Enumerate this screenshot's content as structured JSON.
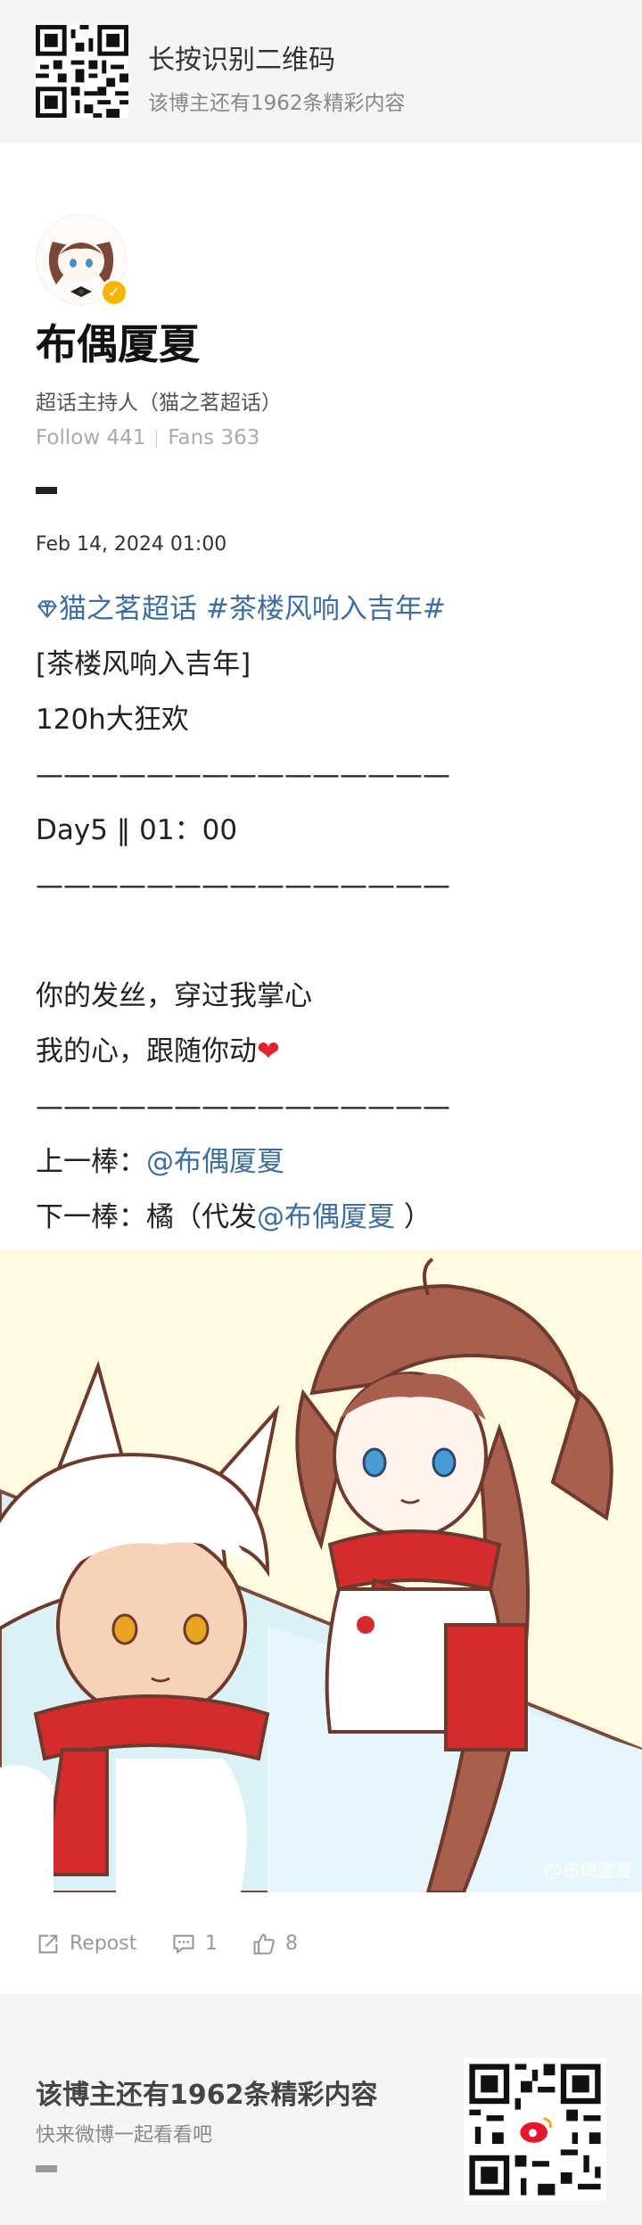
{
  "banner": {
    "title": "长按识别二维码",
    "subtitle": "该博主还有1962条精彩内容"
  },
  "profile": {
    "name": "布偶厦夏",
    "role": "超话主持人（猫之茗超话）",
    "follow_label": "Follow 441",
    "fans_label": "Fans 363",
    "badge_icon": "verified-badge-icon"
  },
  "post": {
    "date": "Feb 14, 2024 01:00",
    "topic_super": "猫之茗超话",
    "topic_tag": "#茶楼风响入吉年#",
    "lines": {
      "l1": "[茶楼风响入吉年]",
      "l2": "120h大狂欢",
      "l3": "———————————————",
      "l4": "Day5 ‖ 01：00",
      "l5": "———————————————",
      "l6": "",
      "l7": "你的发丝，穿过我掌心",
      "l8a": "我的心，跟随你动",
      "l8b": "❤",
      "l9": "———————————————",
      "l10a": "上一棒：",
      "l10b": "@布偶厦夏",
      "l11a": "下一棒：橘（代发",
      "l11b": "@布偶厦夏",
      "l11c": " ）"
    },
    "image_watermark": "@布偶厦夏"
  },
  "actions": {
    "repost_label": "Repost",
    "comment_count": "1",
    "like_count": "8"
  },
  "footer": {
    "title": "该博主还有1962条精彩内容",
    "subtitle": "快来微博一起看看吧"
  },
  "colors": {
    "link": "#3d6e9e",
    "heart": "#e0262b",
    "badge": "#f7b500",
    "scarf": "#d42c2c"
  }
}
